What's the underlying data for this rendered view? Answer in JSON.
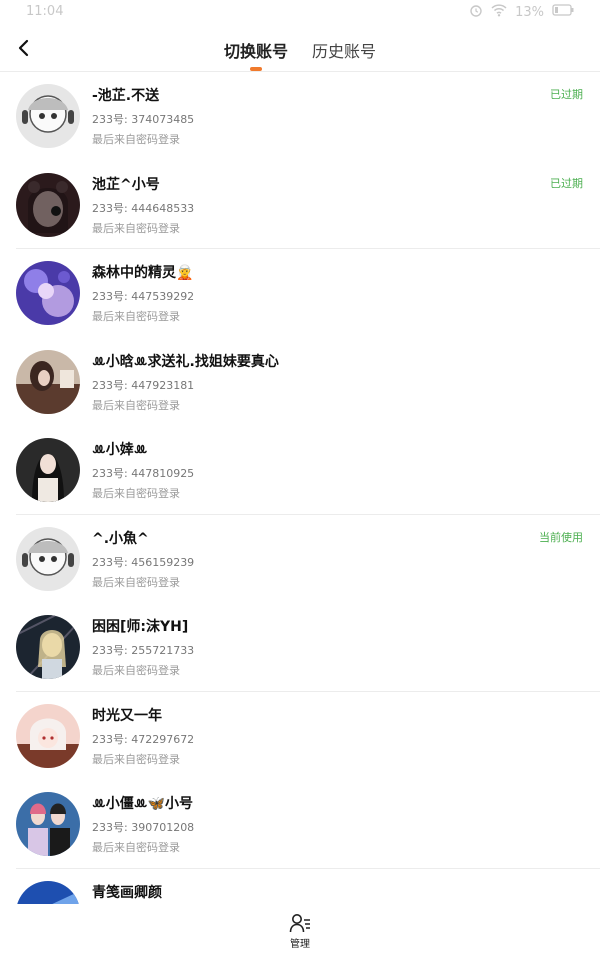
{
  "status_bar": {
    "time": "11:04",
    "battery": "13%"
  },
  "navbar": {
    "tabs": [
      {
        "label": "切换账号",
        "active": true
      },
      {
        "label": "历史账号",
        "active": false
      }
    ],
    "accent_color": "#f07a2d"
  },
  "accounts": [
    {
      "name": "-池芷.不送",
      "uid": "233号: 374073485",
      "login": "最后来自密码登录",
      "status": "已过期"
    },
    {
      "name": "池芷^小号",
      "uid": "233号: 444648533",
      "login": "最后来自密码登录",
      "status": "已过期"
    },
    {
      "name": "森林中的精灵🧝",
      "uid": "233号: 447539292",
      "login": "最后来自密码登录",
      "status": ""
    },
    {
      "name": "ꔛ小晗ꔛ求送礼.找姐妹要真心",
      "uid": "233号: 447923181",
      "login": "最后来自密码登录",
      "status": ""
    },
    {
      "name": "ꔛ小婞ꔛ",
      "uid": "233号: 447810925",
      "login": "最后来自密码登录",
      "status": ""
    },
    {
      "name": "^.小魚^",
      "uid": "233号: 456159239",
      "login": "最后来自密码登录",
      "status": "当前使用"
    },
    {
      "name": "困困[师:沫YH]",
      "uid": "233号: 255721733",
      "login": "最后来自密码登录",
      "status": ""
    },
    {
      "name": "时光又一年",
      "uid": "233号: 472297672",
      "login": "最后来自密码登录",
      "status": ""
    },
    {
      "name": "ꔛ小僵ꔛ🦋小号",
      "uid": "233号: 390701208",
      "login": "最后来自密码登录",
      "status": ""
    },
    {
      "name": "青笺画卿颜",
      "uid": "",
      "login": "",
      "status": ""
    }
  ],
  "status_color": "#4caf50",
  "bottom_bar": {
    "manage_label": "管理"
  }
}
